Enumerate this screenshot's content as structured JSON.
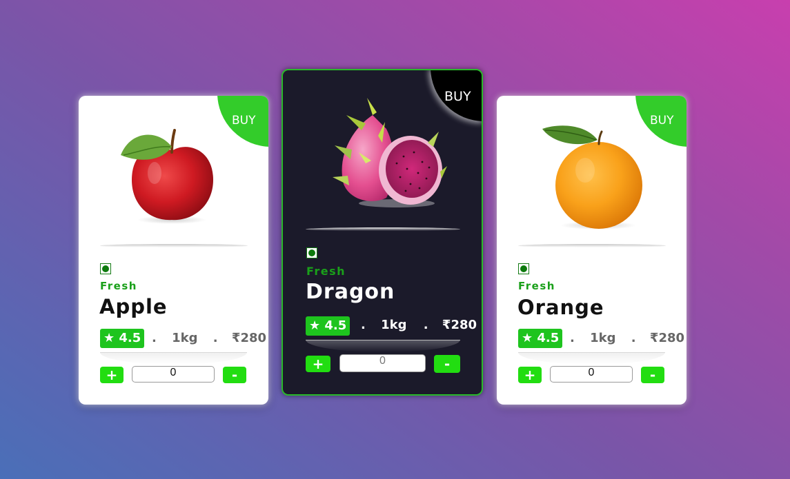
{
  "buy_label": "BUY",
  "veg_mark": "veg-indicator-icon",
  "colors": {
    "accent_green": "#22dd11",
    "rating_green": "#1ec41e",
    "fresh_green": "#1aa01a",
    "dark_card": "#1b1a2a"
  },
  "cards": [
    {
      "fresh_label": "Fresh",
      "name": "Apple",
      "rating": "★ 4.5",
      "sep1": ".",
      "weight": "1kg",
      "sep2": ".",
      "price": "₹280",
      "plus_label": "+",
      "minus_label": "-",
      "quantity": "0",
      "image": "apple-image"
    },
    {
      "fresh_label": "Fresh",
      "name": "Dragon",
      "rating": "★ 4.5",
      "sep1": ".",
      "weight": "1kg",
      "sep2": ".",
      "price": "₹280",
      "plus_label": "+",
      "minus_label": "-",
      "quantity": "0",
      "image": "dragon-fruit-image"
    },
    {
      "fresh_label": "Fresh",
      "name": "Orange",
      "rating": "★ 4.5",
      "sep1": ".",
      "weight": "1kg",
      "sep2": ".",
      "price": "₹280",
      "plus_label": "+",
      "minus_label": "-",
      "quantity": "0",
      "image": "orange-image"
    }
  ]
}
